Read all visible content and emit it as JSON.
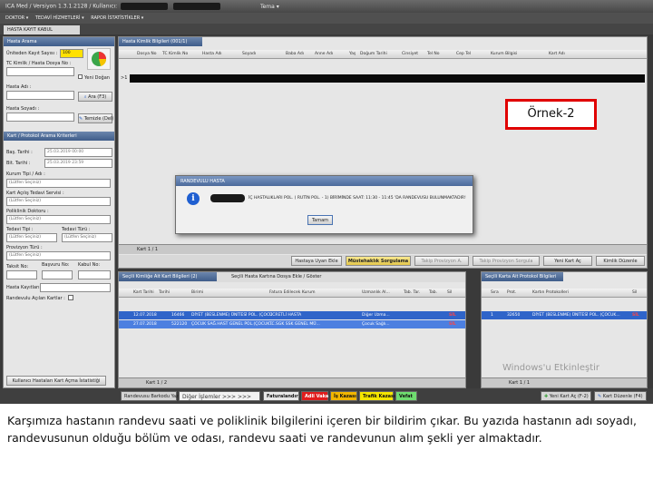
{
  "app": {
    "titlebar": "ICA Med  /  Versiyon 1.3.1.2128  /  Kullanıcı:",
    "titlebar_right": "Tema ▾"
  },
  "menu": [
    "DOKTOR ▾",
    "TEDAVİ HİZMETLERİ ▾",
    "RAPOR İSTATİSTİKLER ▾"
  ],
  "top_tab": "HASTA KAYIT KABUL",
  "left_panel": {
    "header": "Hasta Arama",
    "fields": [
      {
        "label": "Üniteden Kayıt Sayısı :",
        "value": "100"
      },
      {
        "label": "TC Kimlik / Hasta Dosya No :",
        "value": ""
      },
      {
        "label": "Hasta Adı :",
        "value": ""
      },
      {
        "label": "Hasta Soyadı :",
        "value": ""
      }
    ],
    "yeni_dogan": "Yeni Doğan",
    "ara_button": "Ara (F3)",
    "temizle_button": "Temizle (Del)",
    "criteria_header": "Kart / Protokol Arama Kriterleri",
    "bas_tarihi_label": "Baş. Tarihi :",
    "bas_tarihi_value": "25.03.2019 00:00",
    "bit_tarihi_label": "Bit. Tarihi :",
    "bit_tarihi_value": "25.03.2019 23:59",
    "kurum_label": "Kurum Tipi / Adı :",
    "kart_servis_label": "Kart Açılış Tedavi Servisi :",
    "poliklinik_label": "Poliklinik Doktoru :",
    "tedavi_tipi_label": "Tedavi Tipi :",
    "tedavi_turu_label": "Tedavi Türü :",
    "provizyon_label": "Provizyon Türü :",
    "taksit_label": "Taksit No:",
    "basvuru_label": "Başvuru No:",
    "kabul_label": "Kabul No:",
    "hasta_kayitlari_label": "Hasta Kayıtları :",
    "randevulu_label": "Randevulu Açılan Kartlar :",
    "placeholder": "(Lütfen Seçiniz)",
    "stats_button": "Kullanıcı Hastaları Kart Açma İstatistiği"
  },
  "top_grid": {
    "tab": "Hasta Kimlik Bilgileri   (001/1)",
    "columns": [
      "Dosya No",
      "TC Kimlik No",
      "Hasta Adı",
      "Soyadı",
      "Baba Adı",
      "Anne Adı",
      "Yaş",
      "Doğum Tarihi",
      "Cinsiyet",
      "Tel No",
      "Cep Tel",
      "Kurum Bilgisi",
      "Kart Adı"
    ],
    "row_marker": ">1",
    "nav": "Kart 1 / 1",
    "buttons": [
      "Hastaya Uyarı Ekle",
      "Müstehaklık Sorgulama",
      "Takip Provizyon A.",
      "Takip Provizyon Sorgula",
      "Yeni Kart Aç",
      "Kimlik Düzenle"
    ]
  },
  "modal": {
    "title": "RANDEVULU HASTA",
    "message": "İÇ HASTALIKLARI POL. ( RUTİN POL. - 1) BİRİMİNDE SAAT: 11:30 - 11:45 'DA RANDEVUSU BULUNMAKTADIR!",
    "ok_button": "Tamam"
  },
  "annotation": "Örnek-2",
  "mid_grid": {
    "tab1": "Seçili Kimliğe Ait Kart Bilgileri   (2)",
    "tab2": "Seçili Hasta Kartına Dosya Ekle / Göster",
    "columns": [
      "Kart Tarihi",
      "Tarihi",
      "Kurum",
      "Birimi",
      "Fatura Edilecek Kurum",
      "Uzmanlık Al...",
      "Tab. Tar.",
      "Tab.",
      "Sil"
    ],
    "rows": [
      [
        "12.07.2018",
        "16466",
        "DİYET (BESLENME) ÜNİTESİ POL. (ÇOCU",
        "ÜCRETLİ HASTA",
        "Diğer Uzma...",
        "",
        "",
        "SİL"
      ],
      [
        "27.07.2018",
        "522120",
        "ÇOCUK SAĞ.HAST GENEL POL.(ÇOCUK...",
        "TC.SGK SSK GENEL MÜ...",
        "Çocuk Sağlı...",
        "",
        "",
        "SİL"
      ]
    ],
    "nav": "Kart 1 / 2",
    "bottom_buttons": [
      "Randevusu Barkodu Yazdır (F12)",
      "Diğer İşlemler >>> >>>",
      "Faturalandır",
      "Adli Vaka",
      "İş Kazası",
      "Trafik Kazası",
      "Vefat"
    ]
  },
  "right_grid": {
    "tab": "Seçili Karta Ait Protokol Bilgileri",
    "columns": [
      "Sıra",
      "Prot.",
      "Kartın Protokolleri",
      "Sil"
    ],
    "rows": [
      [
        "1",
        "32650",
        "DİYET (BESLENME) ÜNİTESİ POL. (ÇOCUK...",
        "SİL"
      ]
    ],
    "nav": "Kart 1 / 1",
    "buttons": [
      "Yeni Kart Aç (F-2)",
      "Kart Düzenle (F4)"
    ]
  },
  "watermark": "Windows'u Etkinleştir",
  "caption": "Karşımıza hastanın randevu saati ve poliklinik bilgilerini içeren bir bildirim çıkar. Bu yazıda hastanın adı soyadı, randevusunun olduğu bölüm ve odası, randevu saati ve randevunun alım şekli yer almaktadır."
}
